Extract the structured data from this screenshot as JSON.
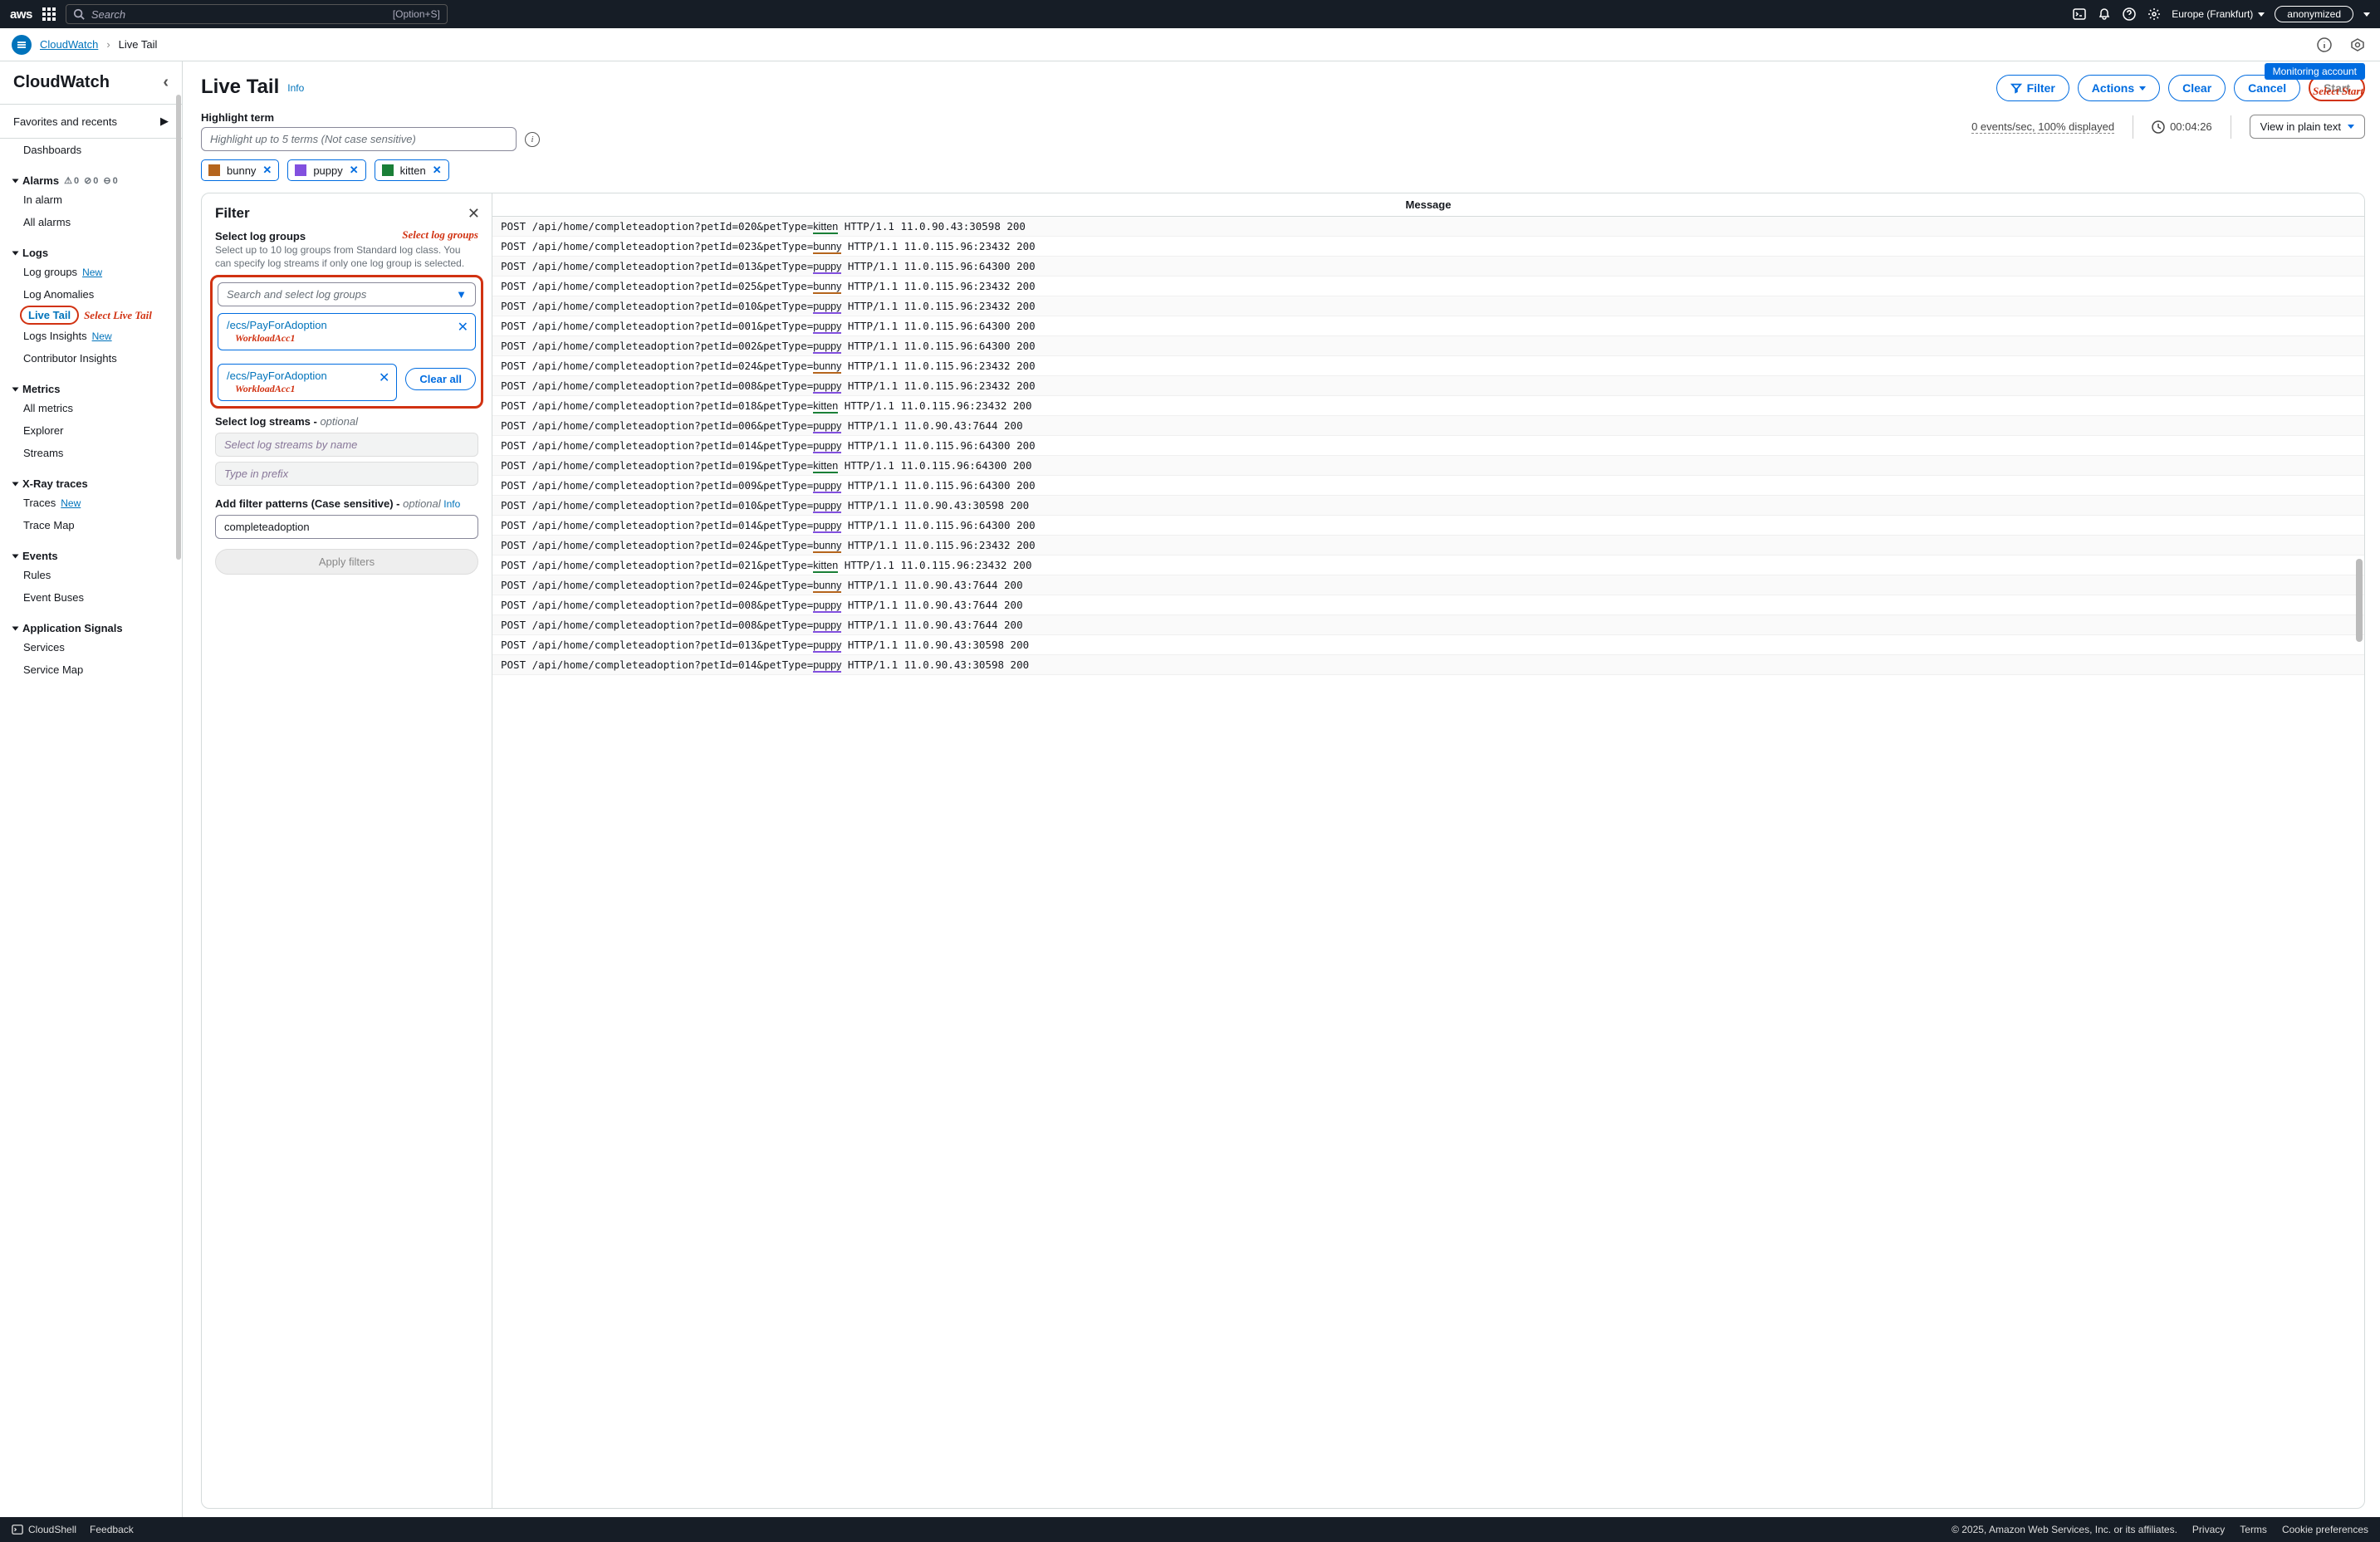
{
  "topnav": {
    "search_placeholder": "Search",
    "search_kbd": "[Option+S]",
    "region": "Europe (Frankfurt)",
    "account": "anonymized"
  },
  "breadcrumb": {
    "service": "CloudWatch",
    "page": "Live Tail"
  },
  "sidebar": {
    "title": "CloudWatch",
    "fav": "Favorites and recents",
    "nav": {
      "dashboards": "Dashboards",
      "alarms": "Alarms",
      "alarm_counts": {
        "tri": "0",
        "ok": "0",
        "dash": "0"
      },
      "in_alarm": "In alarm",
      "all_alarms": "All alarms",
      "logs": "Logs",
      "log_groups": "Log groups",
      "new": "New",
      "log_anomalies": "Log Anomalies",
      "live_tail": "Live Tail",
      "live_tail_ann": "Select Live Tail",
      "logs_insights": "Logs Insights",
      "contributor": "Contributor Insights",
      "metrics": "Metrics",
      "all_metrics": "All metrics",
      "explorer": "Explorer",
      "streams": "Streams",
      "xray": "X-Ray traces",
      "traces": "Traces",
      "trace_map": "Trace Map",
      "events": "Events",
      "rules": "Rules",
      "event_buses": "Event Buses",
      "appsignals": "Application Signals",
      "services": "Services",
      "service_map": "Service Map"
    }
  },
  "main": {
    "monitoring_badge": "Monitoring account",
    "start_ann": "Select Start",
    "title": "Live Tail",
    "info": "Info",
    "buttons": {
      "filter": "Filter",
      "actions": "Actions",
      "clear": "Clear",
      "cancel": "Cancel",
      "start": "Start"
    },
    "highlight": {
      "label": "Highlight term",
      "placeholder": "Highlight up to 5 terms (Not case sensitive)"
    },
    "stats": {
      "events": "0 events/sec, 100% displayed",
      "timer": "00:04:26",
      "view": "View in plain text"
    },
    "chips": [
      {
        "label": "bunny",
        "color": "#b5651d"
      },
      {
        "label": "puppy",
        "color": "#8250df"
      },
      {
        "label": "kitten",
        "color": "#1a7f37"
      }
    ]
  },
  "filter": {
    "title": "Filter",
    "select_lg": "Select log groups",
    "select_lg_ann": "Select log groups",
    "select_lg_help": "Select up to 10 log groups from Standard log class. You can specify log streams if only one log group is selected.",
    "search_lg_placeholder": "Search and select log groups",
    "log_groups": [
      {
        "name": "/ecs/PayForAdoption",
        "acct": "WorkloadAcc1"
      },
      {
        "name": "/ecs/PayForAdoption",
        "acct": "WorkloadAcc1"
      }
    ],
    "clear_all": "Clear all",
    "select_streams": "Select log streams -",
    "optional": " optional",
    "streams_placeholder": "Select log streams by name",
    "prefix_placeholder": "Type in prefix",
    "patterns_label": "Add filter patterns (Case sensitive) -",
    "patterns_info": "Info",
    "pattern_value": "completeadoption",
    "apply": "Apply filters"
  },
  "logs": {
    "header": "Message",
    "lines": [
      {
        "pre": "POST /api/home/completeadoption?petId=020&petType=",
        "hl": "kitten",
        "post": " HTTP/1.1 11.0.90.43:30598 200"
      },
      {
        "pre": "POST /api/home/completeadoption?petId=023&petType=",
        "hl": "bunny",
        "post": " HTTP/1.1 11.0.115.96:23432 200"
      },
      {
        "pre": "POST /api/home/completeadoption?petId=013&petType=",
        "hl": "puppy",
        "post": " HTTP/1.1 11.0.115.96:64300 200"
      },
      {
        "pre": "POST /api/home/completeadoption?petId=025&petType=",
        "hl": "bunny",
        "post": " HTTP/1.1 11.0.115.96:23432 200"
      },
      {
        "pre": "POST /api/home/completeadoption?petId=010&petType=",
        "hl": "puppy",
        "post": " HTTP/1.1 11.0.115.96:23432 200"
      },
      {
        "pre": "POST /api/home/completeadoption?petId=001&petType=",
        "hl": "puppy",
        "post": " HTTP/1.1 11.0.115.96:64300 200"
      },
      {
        "pre": "POST /api/home/completeadoption?petId=002&petType=",
        "hl": "puppy",
        "post": " HTTP/1.1 11.0.115.96:64300 200"
      },
      {
        "pre": "POST /api/home/completeadoption?petId=024&petType=",
        "hl": "bunny",
        "post": " HTTP/1.1 11.0.115.96:23432 200"
      },
      {
        "pre": "POST /api/home/completeadoption?petId=008&petType=",
        "hl": "puppy",
        "post": " HTTP/1.1 11.0.115.96:23432 200"
      },
      {
        "pre": "POST /api/home/completeadoption?petId=018&petType=",
        "hl": "kitten",
        "post": " HTTP/1.1 11.0.115.96:23432 200"
      },
      {
        "pre": "POST /api/home/completeadoption?petId=006&petType=",
        "hl": "puppy",
        "post": " HTTP/1.1 11.0.90.43:7644 200"
      },
      {
        "pre": "POST /api/home/completeadoption?petId=014&petType=",
        "hl": "puppy",
        "post": " HTTP/1.1 11.0.115.96:64300 200"
      },
      {
        "pre": "POST /api/home/completeadoption?petId=019&petType=",
        "hl": "kitten",
        "post": " HTTP/1.1 11.0.115.96:64300 200"
      },
      {
        "pre": "POST /api/home/completeadoption?petId=009&petType=",
        "hl": "puppy",
        "post": " HTTP/1.1 11.0.115.96:64300 200"
      },
      {
        "pre": "POST /api/home/completeadoption?petId=010&petType=",
        "hl": "puppy",
        "post": " HTTP/1.1 11.0.90.43:30598 200"
      },
      {
        "pre": "POST /api/home/completeadoption?petId=014&petType=",
        "hl": "puppy",
        "post": " HTTP/1.1 11.0.115.96:64300 200"
      },
      {
        "pre": "POST /api/home/completeadoption?petId=024&petType=",
        "hl": "bunny",
        "post": " HTTP/1.1 11.0.115.96:23432 200"
      },
      {
        "pre": "POST /api/home/completeadoption?petId=021&petType=",
        "hl": "kitten",
        "post": " HTTP/1.1 11.0.115.96:23432 200"
      },
      {
        "pre": "POST /api/home/completeadoption?petId=024&petType=",
        "hl": "bunny",
        "post": " HTTP/1.1 11.0.90.43:7644 200"
      },
      {
        "pre": "POST /api/home/completeadoption?petId=008&petType=",
        "hl": "puppy",
        "post": " HTTP/1.1 11.0.90.43:7644 200"
      },
      {
        "pre": "POST /api/home/completeadoption?petId=008&petType=",
        "hl": "puppy",
        "post": " HTTP/1.1 11.0.90.43:7644 200"
      },
      {
        "pre": "POST /api/home/completeadoption?petId=013&petType=",
        "hl": "puppy",
        "post": " HTTP/1.1 11.0.90.43:30598 200"
      },
      {
        "pre": "POST /api/home/completeadoption?petId=014&petType=",
        "hl": "puppy",
        "post": " HTTP/1.1 11.0.90.43:30598 200"
      }
    ]
  },
  "footer": {
    "cloudshell": "CloudShell",
    "feedback": "Feedback",
    "copyright": "© 2025, Amazon Web Services, Inc. or its affiliates.",
    "privacy": "Privacy",
    "terms": "Terms",
    "cookies": "Cookie preferences"
  }
}
